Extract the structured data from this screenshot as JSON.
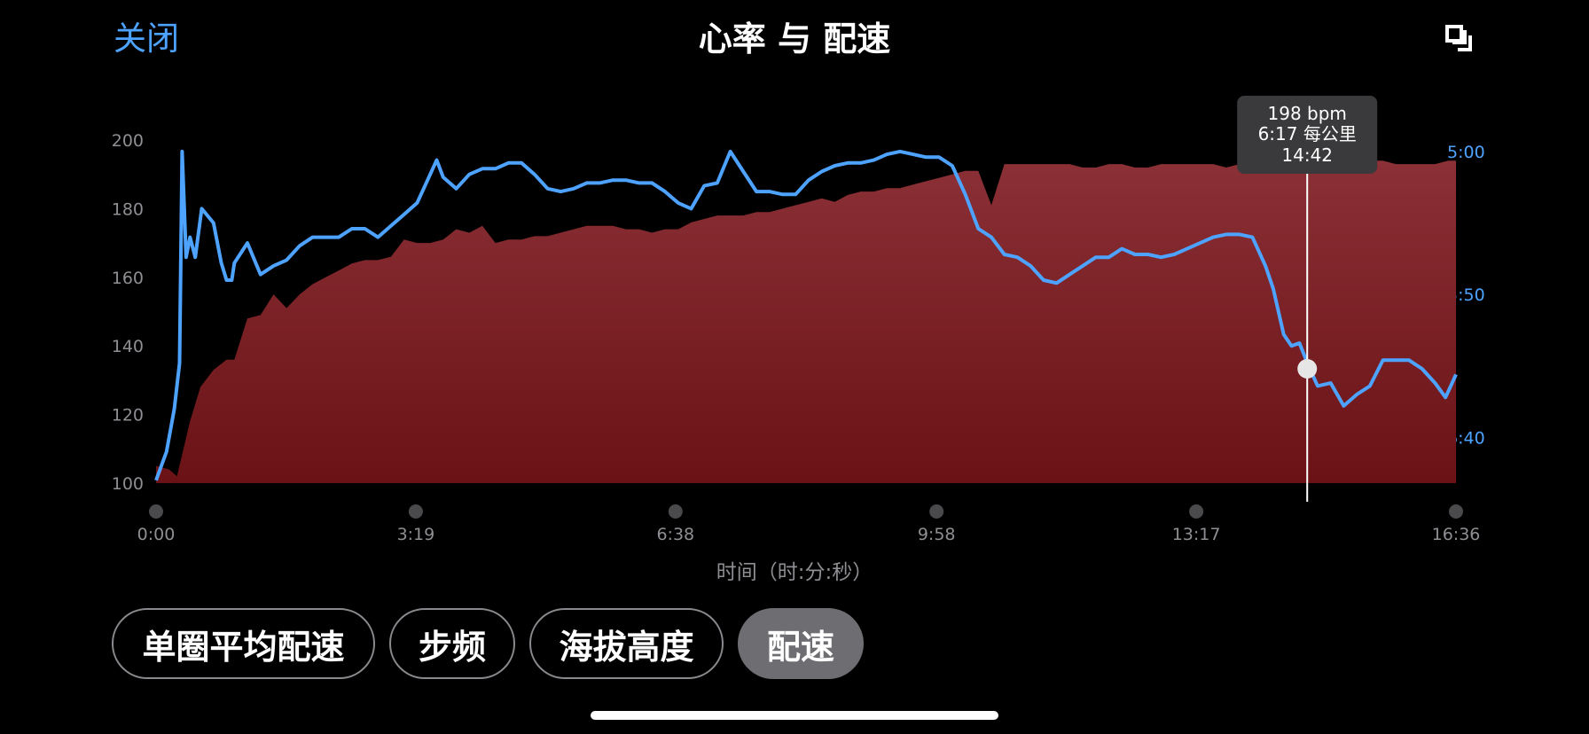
{
  "header": {
    "close_label": "关闭",
    "title": "心率 与 配速",
    "expand_icon": "fullscreen-icon"
  },
  "chart_data": {
    "type": "area",
    "x_axis": {
      "label": "时间（时:分:秒）",
      "unit": "seconds",
      "range": [
        0,
        996
      ],
      "ticks": [
        0,
        199,
        398,
        598,
        797,
        996
      ],
      "tick_labels": [
        "0:00",
        "3:19",
        "6:38",
        "9:58",
        "13:17",
        "16:36"
      ]
    },
    "y_left": {
      "range": [
        100,
        200
      ],
      "ticks": [
        100,
        120,
        140,
        160,
        180,
        200
      ],
      "tick_labels": [
        "100",
        "120",
        "140",
        "160",
        "180",
        "200"
      ]
    },
    "y_right": {
      "unit": "min per km",
      "range_seconds": [
        296,
        416
      ],
      "ticks": [
        300,
        350,
        400
      ],
      "tick_labels": [
        "5:00",
        "5:50",
        "6:40"
      ]
    },
    "series": [
      {
        "key": "heart_rate",
        "axis": "left",
        "color": "#8b2a30",
        "points": [
          [
            0,
            105
          ],
          [
            10,
            104
          ],
          [
            16,
            102
          ],
          [
            26,
            118
          ],
          [
            34,
            128
          ],
          [
            44,
            133
          ],
          [
            54,
            136
          ],
          [
            60,
            136
          ],
          [
            70,
            148
          ],
          [
            80,
            149
          ],
          [
            90,
            155
          ],
          [
            100,
            151
          ],
          [
            110,
            155
          ],
          [
            120,
            158
          ],
          [
            130,
            160
          ],
          [
            140,
            162
          ],
          [
            150,
            164
          ],
          [
            160,
            165
          ],
          [
            170,
            165
          ],
          [
            180,
            166
          ],
          [
            190,
            171
          ],
          [
            200,
            170
          ],
          [
            210,
            170
          ],
          [
            220,
            171
          ],
          [
            230,
            174
          ],
          [
            240,
            173
          ],
          [
            250,
            175
          ],
          [
            260,
            170
          ],
          [
            270,
            171
          ],
          [
            280,
            171
          ],
          [
            290,
            172
          ],
          [
            300,
            172
          ],
          [
            310,
            173
          ],
          [
            320,
            174
          ],
          [
            330,
            175
          ],
          [
            340,
            175
          ],
          [
            350,
            175
          ],
          [
            360,
            174
          ],
          [
            370,
            174
          ],
          [
            380,
            173
          ],
          [
            390,
            174
          ],
          [
            400,
            174
          ],
          [
            410,
            176
          ],
          [
            420,
            177
          ],
          [
            430,
            178
          ],
          [
            440,
            178
          ],
          [
            450,
            178
          ],
          [
            460,
            179
          ],
          [
            470,
            179
          ],
          [
            480,
            180
          ],
          [
            490,
            181
          ],
          [
            500,
            182
          ],
          [
            510,
            183
          ],
          [
            520,
            182
          ],
          [
            530,
            184
          ],
          [
            540,
            185
          ],
          [
            550,
            185
          ],
          [
            560,
            186
          ],
          [
            570,
            186
          ],
          [
            580,
            187
          ],
          [
            590,
            188
          ],
          [
            600,
            189
          ],
          [
            610,
            190
          ],
          [
            620,
            191
          ],
          [
            630,
            191
          ],
          [
            640,
            181
          ],
          [
            650,
            193
          ],
          [
            660,
            193
          ],
          [
            670,
            193
          ],
          [
            680,
            193
          ],
          [
            690,
            193
          ],
          [
            700,
            193
          ],
          [
            710,
            192
          ],
          [
            720,
            192
          ],
          [
            730,
            193
          ],
          [
            740,
            193
          ],
          [
            750,
            192
          ],
          [
            760,
            192
          ],
          [
            770,
            193
          ],
          [
            780,
            193
          ],
          [
            790,
            193
          ],
          [
            800,
            193
          ],
          [
            810,
            193
          ],
          [
            820,
            192
          ],
          [
            830,
            193
          ],
          [
            840,
            193
          ],
          [
            850,
            193
          ],
          [
            860,
            193
          ],
          [
            870,
            194
          ],
          [
            880,
            193
          ],
          [
            890,
            193
          ],
          [
            900,
            193
          ],
          [
            910,
            193
          ],
          [
            920,
            194
          ],
          [
            930,
            194
          ],
          [
            940,
            194
          ],
          [
            950,
            193
          ],
          [
            960,
            193
          ],
          [
            970,
            193
          ],
          [
            980,
            193
          ],
          [
            990,
            194
          ],
          [
            996,
            194
          ]
        ]
      },
      {
        "key": "pace",
        "axis": "right",
        "color": "#4da3ff",
        "points": [
          [
            0,
            415
          ],
          [
            8,
            405
          ],
          [
            14,
            390
          ],
          [
            18,
            374
          ],
          [
            20,
            300
          ],
          [
            23,
            337
          ],
          [
            26,
            330
          ],
          [
            30,
            337
          ],
          [
            35,
            320
          ],
          [
            44,
            325
          ],
          [
            50,
            339
          ],
          [
            54,
            345
          ],
          [
            58,
            345
          ],
          [
            60,
            339
          ],
          [
            70,
            332
          ],
          [
            80,
            343
          ],
          [
            90,
            340
          ],
          [
            100,
            338
          ],
          [
            110,
            333
          ],
          [
            120,
            330
          ],
          [
            130,
            330
          ],
          [
            140,
            330
          ],
          [
            150,
            327
          ],
          [
            160,
            327
          ],
          [
            170,
            330
          ],
          [
            180,
            326
          ],
          [
            190,
            322
          ],
          [
            200,
            318
          ],
          [
            208,
            310
          ],
          [
            215,
            303
          ],
          [
            220,
            309
          ],
          [
            230,
            313
          ],
          [
            240,
            308
          ],
          [
            250,
            306
          ],
          [
            260,
            306
          ],
          [
            270,
            304
          ],
          [
            280,
            304
          ],
          [
            290,
            308
          ],
          [
            300,
            313
          ],
          [
            310,
            314
          ],
          [
            320,
            313
          ],
          [
            330,
            311
          ],
          [
            340,
            311
          ],
          [
            350,
            310
          ],
          [
            360,
            310
          ],
          [
            370,
            311
          ],
          [
            380,
            311
          ],
          [
            390,
            314
          ],
          [
            400,
            318
          ],
          [
            410,
            320
          ],
          [
            420,
            312
          ],
          [
            430,
            311
          ],
          [
            440,
            300
          ],
          [
            450,
            307
          ],
          [
            460,
            314
          ],
          [
            470,
            314
          ],
          [
            480,
            315
          ],
          [
            490,
            315
          ],
          [
            500,
            310
          ],
          [
            510,
            307
          ],
          [
            520,
            305
          ],
          [
            530,
            304
          ],
          [
            540,
            304
          ],
          [
            550,
            303
          ],
          [
            560,
            301
          ],
          [
            570,
            300
          ],
          [
            580,
            301
          ],
          [
            590,
            302
          ],
          [
            600,
            302
          ],
          [
            610,
            305
          ],
          [
            620,
            315
          ],
          [
            630,
            327
          ],
          [
            640,
            330
          ],
          [
            650,
            336
          ],
          [
            660,
            337
          ],
          [
            670,
            340
          ],
          [
            680,
            345
          ],
          [
            690,
            346
          ],
          [
            700,
            343
          ],
          [
            710,
            340
          ],
          [
            720,
            337
          ],
          [
            730,
            337
          ],
          [
            740,
            334
          ],
          [
            750,
            336
          ],
          [
            760,
            336
          ],
          [
            770,
            337
          ],
          [
            780,
            336
          ],
          [
            790,
            334
          ],
          [
            800,
            332
          ],
          [
            810,
            330
          ],
          [
            820,
            329
          ],
          [
            830,
            329
          ],
          [
            840,
            330
          ],
          [
            850,
            340
          ],
          [
            856,
            348
          ],
          [
            864,
            364
          ],
          [
            870,
            368
          ],
          [
            876,
            367
          ],
          [
            884,
            376
          ],
          [
            890,
            382
          ],
          [
            900,
            381
          ],
          [
            910,
            389
          ],
          [
            920,
            385
          ],
          [
            930,
            382
          ],
          [
            940,
            373
          ],
          [
            950,
            373
          ],
          [
            960,
            373
          ],
          [
            970,
            376
          ],
          [
            980,
            381
          ],
          [
            988,
            386
          ],
          [
            996,
            378
          ]
        ]
      }
    ],
    "tooltip": {
      "x": 882,
      "heart_rate_label": "198 bpm",
      "pace_label": "6:17 每公里",
      "time_label": "14:42",
      "marker_pace": 376
    }
  },
  "metric_buttons": [
    {
      "label": "单圈平均配速",
      "active": false
    },
    {
      "label": "步频",
      "active": false
    },
    {
      "label": "海拔高度",
      "active": false
    },
    {
      "label": "配速",
      "active": true
    }
  ]
}
